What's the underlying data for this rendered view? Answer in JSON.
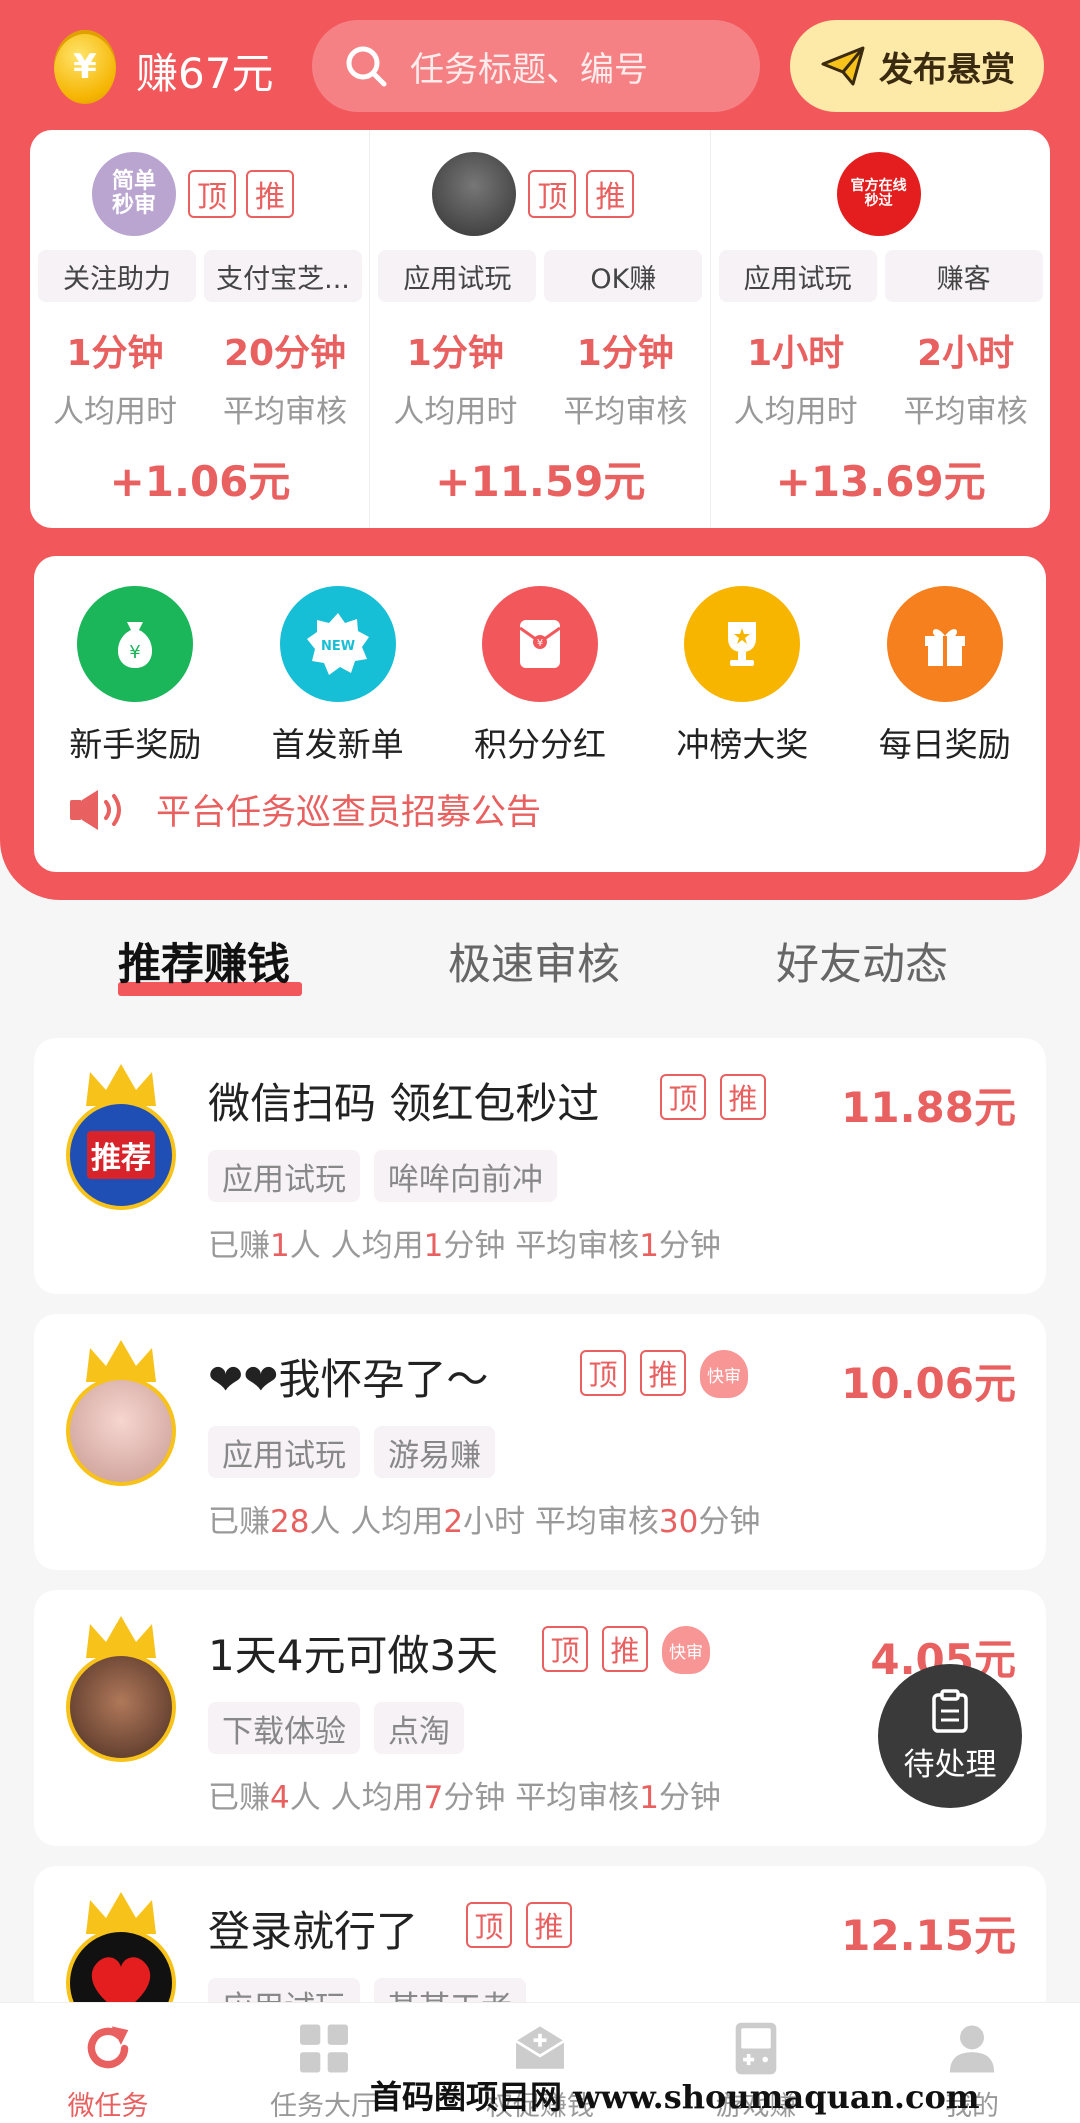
{
  "header": {
    "earned_label": "赚67元",
    "coin_symbol": "¥",
    "search_placeholder": "任务标题、编号",
    "publish_label": "发布悬赏"
  },
  "featured": [
    {
      "avatar_text": "简单\n秒审",
      "avatar_color": "#c8b8d8",
      "badge_top": "顶",
      "badge_push": "推",
      "tags": [
        "关注助力",
        "支付宝芝..."
      ],
      "time_avg": "1分钟",
      "review_avg": "20分钟",
      "time_label": "人均用时",
      "review_label": "平均审核",
      "amount": "+1.06元"
    },
    {
      "avatar_text": "",
      "avatar_color": "#555555",
      "badge_top": "顶",
      "badge_push": "推",
      "tags": [
        "应用试玩",
        "OK赚"
      ],
      "time_avg": "1分钟",
      "review_avg": "1分钟",
      "time_label": "人均用时",
      "review_label": "平均审核",
      "amount": "+11.59元"
    },
    {
      "avatar_text": "官方在线\n秒过",
      "avatar_color": "#e41e1e",
      "badge_top": "",
      "badge_push": "",
      "tags": [
        "应用试玩",
        "赚客"
      ],
      "time_avg": "1小时",
      "review_avg": "2小时",
      "time_label": "人均用时",
      "review_label": "平均审核",
      "amount": "+13.69元"
    }
  ],
  "menu": {
    "items": [
      {
        "label": "新手奖励",
        "icon": "money-bag-icon",
        "color": "#1bb55a"
      },
      {
        "label": "首发新单",
        "icon": "new-badge-icon",
        "color": "#17bfd6"
      },
      {
        "label": "积分分红",
        "icon": "red-envelope-icon",
        "color": "#f2575b"
      },
      {
        "label": "冲榜大奖",
        "icon": "trophy-icon",
        "color": "#f7b500"
      },
      {
        "label": "每日奖励",
        "icon": "gift-icon",
        "color": "#f7801e"
      }
    ],
    "notice": "平台任务巡查员招募公告"
  },
  "tabs": [
    "推荐赚钱",
    "极速审核",
    "好友动态"
  ],
  "tasks": [
    {
      "title": "微信扫码 领红包秒过",
      "badge_top": "顶",
      "badge_push": "推",
      "badge_fast": "",
      "price": "11.88元",
      "tags": [
        "应用试玩",
        "哞哞向前冲"
      ],
      "earned_pre": "已赚",
      "earned": "1",
      "earned_unit": "人",
      "time_pre": "人均用",
      "time_num": "1",
      "time_unit": "分钟",
      "review_pre": "平均审核",
      "review_num": "1",
      "review_unit": "分钟",
      "avatar_text": "推荐"
    },
    {
      "title": "❤❤我怀孕了～",
      "badge_top": "顶",
      "badge_push": "推",
      "badge_fast": "快审",
      "price": "10.06元",
      "tags": [
        "应用试玩",
        "游易赚"
      ],
      "earned_pre": "已赚",
      "earned": "28",
      "earned_unit": "人",
      "time_pre": "人均用",
      "time_num": "2",
      "time_unit": "小时",
      "review_pre": "平均审核",
      "review_num": "30",
      "review_unit": "分钟",
      "avatar_text": ""
    },
    {
      "title": "1天4元可做3天",
      "badge_top": "顶",
      "badge_push": "推",
      "badge_fast": "快审",
      "price": "4.05元",
      "tags": [
        "下载体验",
        "点淘"
      ],
      "earned_pre": "已赚",
      "earned": "4",
      "earned_unit": "人",
      "time_pre": "人均用",
      "time_num": "7",
      "time_unit": "分钟",
      "review_pre": "平均审核",
      "review_num": "1",
      "review_unit": "分钟",
      "avatar_text": ""
    },
    {
      "title": "登录就行了",
      "badge_top": "顶",
      "badge_push": "推",
      "badge_fast": "",
      "price": "12.15元",
      "tags": [
        "应用试玩",
        "某某工者"
      ],
      "earned_pre": "",
      "earned": "",
      "earned_unit": "",
      "time_pre": "",
      "time_num": "",
      "time_unit": "",
      "review_pre": "",
      "review_num": "",
      "review_unit": "",
      "avatar_text": ""
    }
  ],
  "pending_label": "待处理",
  "bottom_nav": [
    {
      "label": "微任务",
      "icon": "refresh-icon"
    },
    {
      "label": "任务大厅",
      "icon": "grid-icon"
    },
    {
      "label": "权促赚钱",
      "icon": "box-icon"
    },
    {
      "label": "游戏赚",
      "icon": "gamepad-icon"
    },
    {
      "label": "我的",
      "icon": "user-icon"
    }
  ],
  "watermark": "首码圈项目网 www.shoumaquan.com",
  "colors": {
    "accent": "#f2575b",
    "price": "#e8605f"
  }
}
